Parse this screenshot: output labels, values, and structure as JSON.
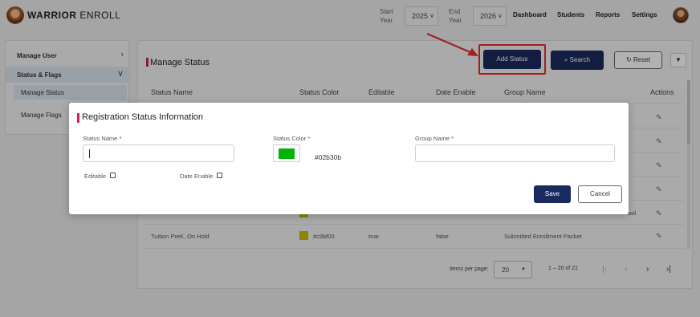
{
  "header": {
    "brand_bold": "WARRIOR",
    "brand_light": "ENROLL",
    "start_year_label": "Start\nYear",
    "start_year_label_1": "Start",
    "start_year_label_2": "Year",
    "start_year_value": "2025",
    "end_year_label_1": "End",
    "end_year_label_2": "Year",
    "end_year_value": "2026",
    "nav": [
      "Dashboard",
      "Students",
      "Reports",
      "Settings"
    ]
  },
  "sidebar": {
    "manage_user": "Manage User",
    "status_flags": "Status & Flags",
    "manage_status": "Manage Status",
    "manage_flags": "Manage Flags"
  },
  "main": {
    "title": "Manage Status",
    "add_status": "Add Status",
    "search": "Search",
    "reset": "Reset",
    "columns": [
      "Status Name",
      "Status Color",
      "Editable",
      "Date Enable",
      "Group Name",
      "Actions"
    ],
    "rows": [
      {
        "name": "",
        "color": "",
        "hex": "",
        "editable": "",
        "date_enable": "",
        "group": ""
      },
      {
        "name": "",
        "color": "",
        "hex": "",
        "editable": "",
        "date_enable": "",
        "group": ""
      },
      {
        "name": "",
        "color": "",
        "hex": "",
        "editable": "",
        "date_enable": "",
        "group": ""
      },
      {
        "name": "",
        "color": "",
        "hex": "",
        "editable": "",
        "date_enable": "",
        "group": ""
      },
      {
        "name": "",
        "color": "#c9bf00",
        "hex": "",
        "editable": "",
        "date_enable": "",
        "group": "ool"
      },
      {
        "name": "Tuition PreK, On Hold",
        "color": "#c9bf00",
        "hex": "#c9bf00",
        "editable": "true",
        "date_enable": "false",
        "group": "Submitted Enrollment Packet"
      }
    ]
  },
  "pagination": {
    "items_per_page_label": "Items per page:",
    "items_per_page": "20",
    "range": "1 – 20 of 21"
  },
  "dialog": {
    "title": "Registration Status Information",
    "status_name_label": "Status Name",
    "status_color_label": "Status Color",
    "group_name_label": "Group Name",
    "required_mark": "*",
    "status_name_value": "",
    "group_name_value": "",
    "color_value": "#02b30b",
    "color_hex_text": "#02b30b",
    "editable_label": "Editable",
    "date_enable_label": "Date Enable",
    "save": "Save",
    "cancel": "Cancel"
  },
  "colors": {
    "primary": "#1b2a5e",
    "accent": "#d0214e",
    "highlight": "#e53030"
  },
  "icons": {
    "search": "search-icon",
    "reset": "refresh-icon",
    "filter": "filter-icon",
    "edit": "edit-icon",
    "chevron_right": "chevron-right-icon",
    "chevron_down": "chevron-down-icon"
  }
}
